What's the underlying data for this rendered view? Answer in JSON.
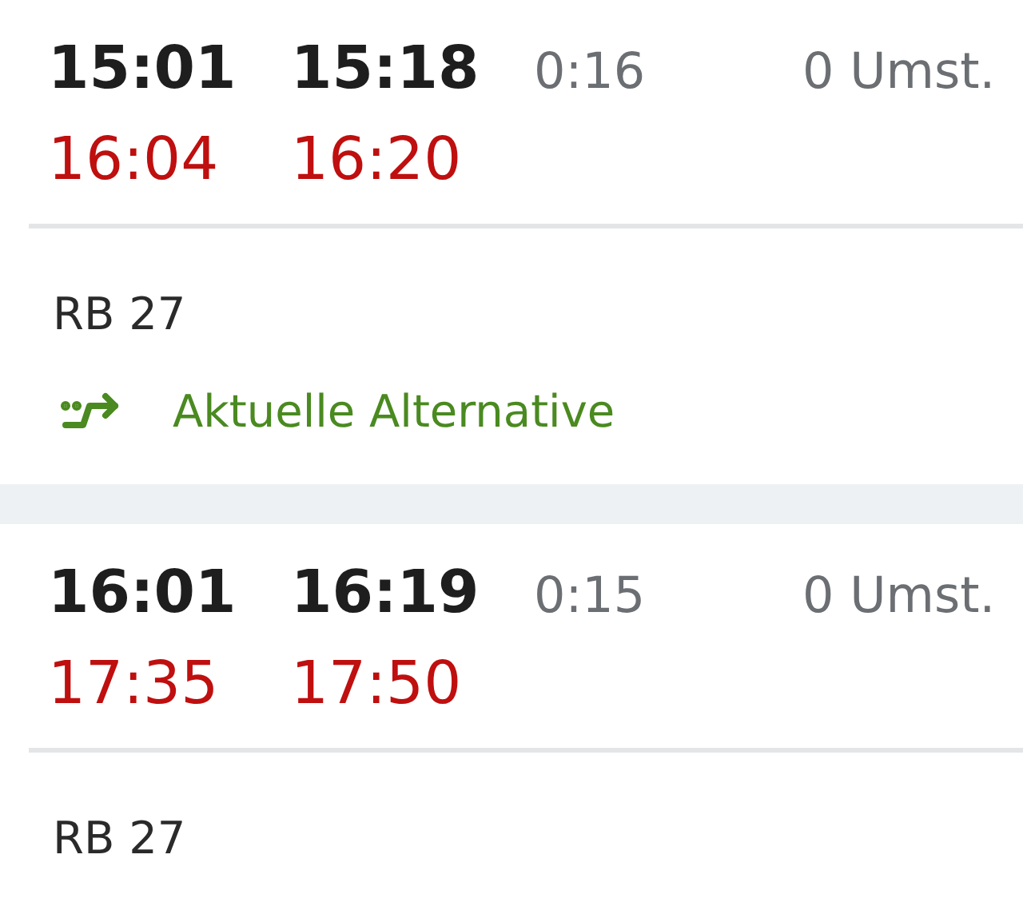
{
  "journeys": [
    {
      "departure": "15:01",
      "arrival": "15:18",
      "duration": "0:16",
      "transfers": "0 Umst.",
      "actual_departure": "16:04",
      "actual_arrival": "16:20",
      "line": "RB 27",
      "alternative": "Aktuelle Alternative"
    },
    {
      "departure": "16:01",
      "arrival": "16:19",
      "duration": "0:15",
      "transfers": "0 Umst.",
      "actual_departure": "17:35",
      "actual_arrival": "17:50",
      "line": "RB 27"
    }
  ]
}
